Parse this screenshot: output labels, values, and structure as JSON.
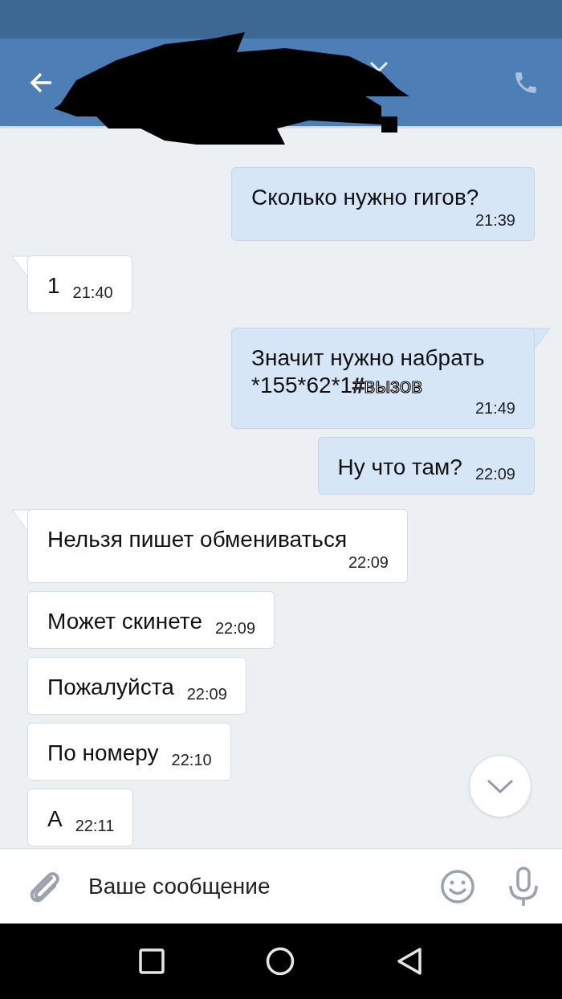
{
  "header": {
    "has_call": true
  },
  "messages": [
    {
      "kind": "sent",
      "tail": false,
      "text": "Сколько нужно гигов?",
      "time": "21:39"
    },
    {
      "kind": "received",
      "tail": true,
      "text": "1",
      "time": "21:40"
    },
    {
      "kind": "sent",
      "tail": true,
      "text": "Значит нужно набрать *155*62*1",
      "outlined_suffix": "#вызов",
      "time": "21:49"
    },
    {
      "kind": "sent",
      "tail": false,
      "text": "Ну что там?",
      "time": "22:09"
    },
    {
      "kind": "received",
      "tail": true,
      "text": "Нельзя пишет обмениваться",
      "time": "22:09"
    },
    {
      "kind": "received",
      "tail": false,
      "text": "Может скинете",
      "time": "22:09"
    },
    {
      "kind": "received",
      "tail": false,
      "text": "Пожалуйста",
      "time": "22:09"
    },
    {
      "kind": "received",
      "tail": false,
      "text": "По номеру",
      "time": "22:10"
    },
    {
      "kind": "received",
      "tail": false,
      "text": "А",
      "time": "22:11"
    }
  ],
  "composer": {
    "placeholder": "Ваше сообщение"
  }
}
